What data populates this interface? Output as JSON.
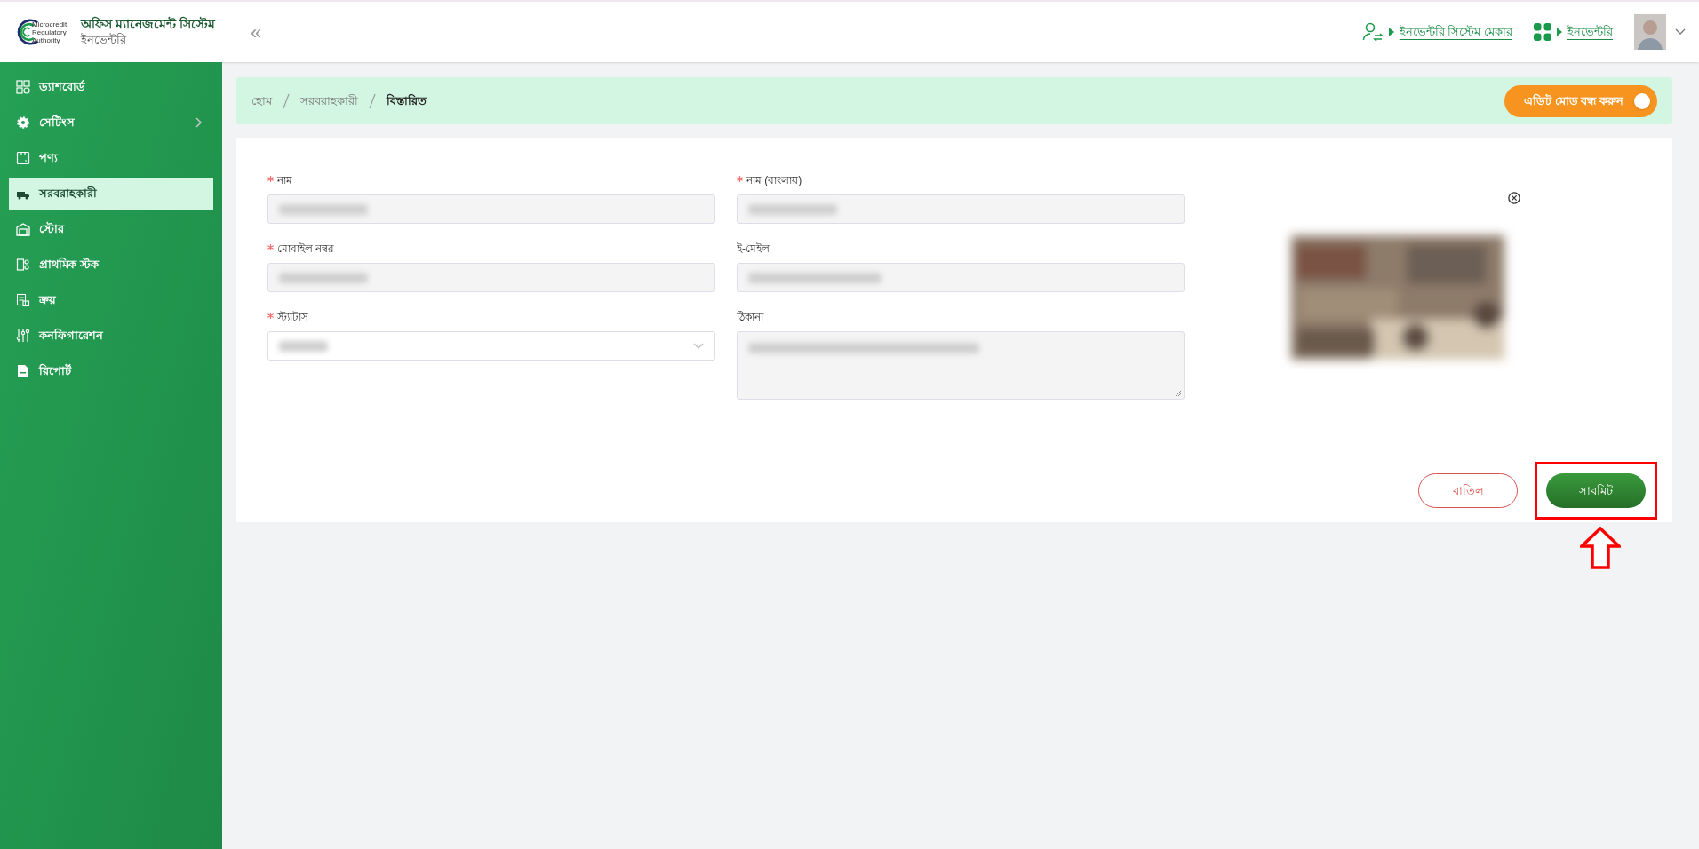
{
  "header": {
    "logo_text": [
      "Microcredit",
      "Regulatory",
      "Authority"
    ],
    "title": "অফিস ম্যানেজমেন্ট সিস্টেম",
    "subtitle": "ইনভেন্টরি",
    "collapse": "«",
    "links": [
      {
        "label": "ইনভেন্টরি সিস্টেম মেকার"
      },
      {
        "label": "ইনভেন্টরি"
      }
    ]
  },
  "sidebar": {
    "items": [
      {
        "label": "ড্যাশবোর্ড",
        "selected": false,
        "has_submenu": false
      },
      {
        "label": "সেটিংস",
        "selected": false,
        "has_submenu": true
      },
      {
        "label": "পণ্য",
        "selected": false,
        "has_submenu": false
      },
      {
        "label": "সরবরাহকারী",
        "selected": true,
        "has_submenu": false
      },
      {
        "label": "স্টোর",
        "selected": false,
        "has_submenu": false
      },
      {
        "label": "প্রাথমিক স্টক",
        "selected": false,
        "has_submenu": false
      },
      {
        "label": "ক্রয়",
        "selected": false,
        "has_submenu": false
      },
      {
        "label": "কনফিগারেশন",
        "selected": false,
        "has_submenu": false
      },
      {
        "label": "রিপোর্ট",
        "selected": false,
        "has_submenu": false
      }
    ]
  },
  "breadcrumb": [
    {
      "label": "হোম",
      "current": false
    },
    {
      "label": "সরবরাহকারী",
      "current": false
    },
    {
      "label": "বিস্তারিত",
      "current": true
    }
  ],
  "edit_toggle": {
    "label": "এডিট মোড বন্ধ করুন",
    "on": true
  },
  "form": {
    "fields": [
      {
        "label": "নাম",
        "required": true,
        "kind": "input"
      },
      {
        "label": "নাম (বাংলায়)",
        "required": true,
        "kind": "input"
      },
      {
        "label": "মোবাইল নম্বর",
        "required": true,
        "kind": "input"
      },
      {
        "label": "ই-মেইল",
        "required": false,
        "kind": "input"
      },
      {
        "label": "স্ট্যাটাস",
        "required": true,
        "kind": "select"
      },
      {
        "label": "ঠিকানা",
        "required": false,
        "kind": "textarea"
      }
    ],
    "buttons": [
      {
        "label": "বাতিল",
        "kind": "cancel"
      },
      {
        "label": "সাবমিট",
        "kind": "submit",
        "highlighted": true
      }
    ]
  }
}
